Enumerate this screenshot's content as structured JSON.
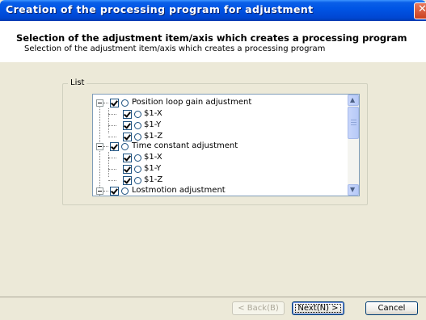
{
  "window": {
    "title": "Creation of the processing program for adjustment",
    "close_glyph": "✕"
  },
  "header": {
    "title": "Selection of the adjustment item/axis which creates a processing program",
    "subtitle": "Selection of the adjustment item/axis which creates a processing program"
  },
  "group": {
    "label": "List"
  },
  "tree": {
    "items": [
      {
        "label": "Position loop gain adjustment",
        "level": 0,
        "checked": true
      },
      {
        "label": "$1-X",
        "level": 1,
        "checked": true
      },
      {
        "label": "$1-Y",
        "level": 1,
        "checked": true
      },
      {
        "label": "$1-Z",
        "level": 1,
        "checked": true
      },
      {
        "label": "Time constant adjustment",
        "level": 0,
        "checked": true
      },
      {
        "label": "$1-X",
        "level": 1,
        "checked": true
      },
      {
        "label": "$1-Y",
        "level": 1,
        "checked": true
      },
      {
        "label": "$1-Z",
        "level": 1,
        "checked": true
      },
      {
        "label": "Lostmotion adjustment",
        "level": 0,
        "checked": true
      }
    ]
  },
  "scrollbar": {
    "up_glyph": "▲",
    "down_glyph": "▼"
  },
  "buttons": {
    "back": "< Back(B)",
    "next": "Next(N) >",
    "cancel": "Cancel"
  }
}
